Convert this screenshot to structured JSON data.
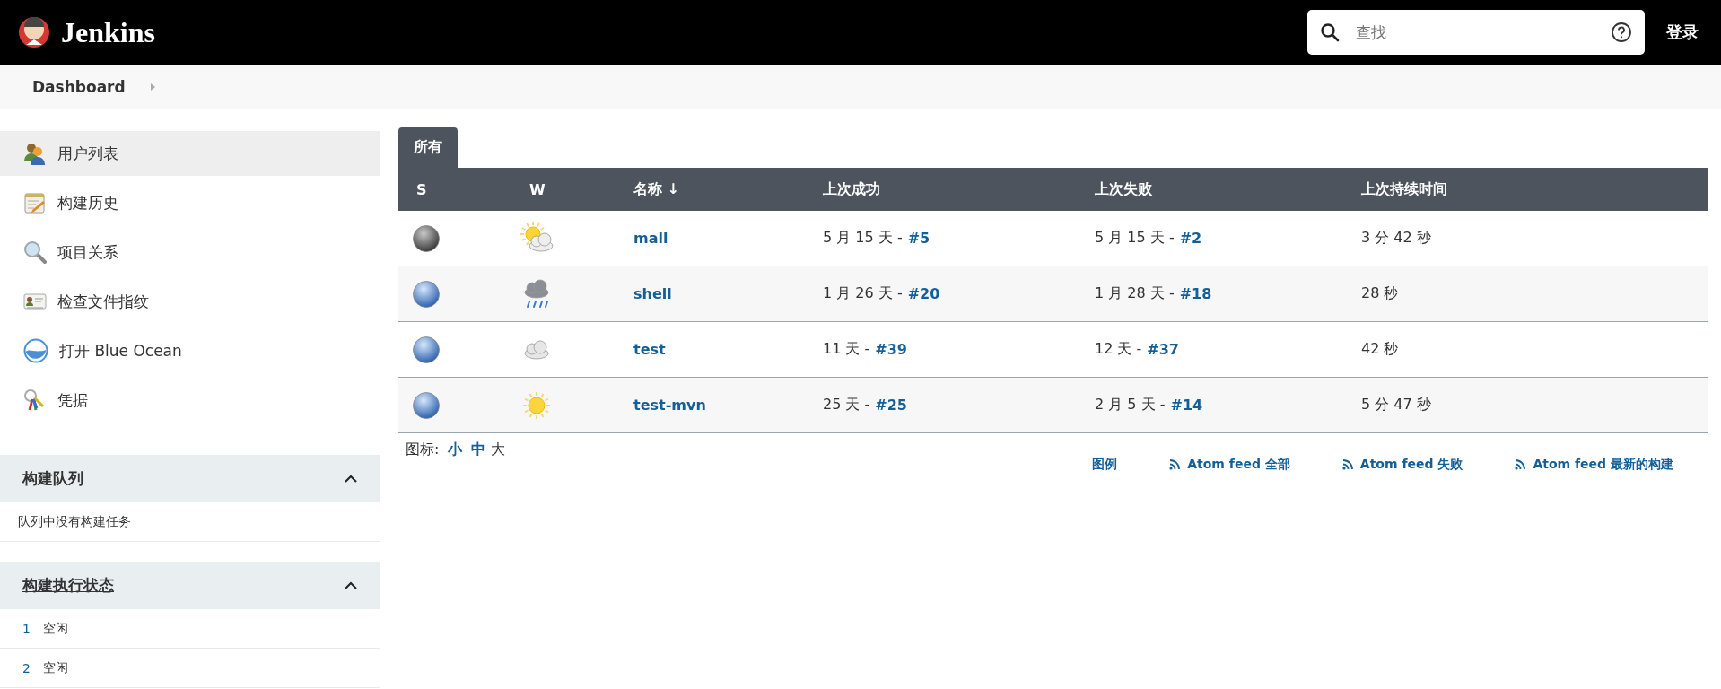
{
  "header": {
    "logo": "Jenkins",
    "search": {
      "placeholder": "查找"
    },
    "login": "登录"
  },
  "breadcrumb": [
    "Dashboard"
  ],
  "sidebar": {
    "items": [
      {
        "label": "用户列表",
        "selected": true
      },
      {
        "label": "构建历史",
        "selected": false
      },
      {
        "label": "项目关系",
        "selected": false
      },
      {
        "label": "检查文件指纹",
        "selected": false
      },
      {
        "label": "打开 Blue Ocean",
        "selected": false
      },
      {
        "label": "凭据",
        "selected": false
      }
    ]
  },
  "queue": {
    "title": "构建队列",
    "expanded": true,
    "message": "队列中没有构建任务"
  },
  "executors": {
    "title": "构建执行状态",
    "expanded": true,
    "rows": [
      {
        "number": "1",
        "status": "空闲"
      },
      {
        "number": "2",
        "status": "空闲"
      }
    ]
  },
  "tabs": [
    {
      "label": "所有",
      "selected": true
    }
  ],
  "table": {
    "columns": [
      "S",
      "W",
      "名称 ↓",
      "上次成功",
      "上次失败",
      "上次持续时间"
    ],
    "rows": [
      {
        "status_icon": {
          "kind": "grey"
        },
        "weather_icon": {
          "kind": "sun-cloud"
        },
        "name": "mall",
        "last_success": {
          "ago": "5 月 15 天 -",
          "build": "#5"
        },
        "last_failure": {
          "ago": "5 月 15 天 -",
          "build": "#2"
        },
        "duration": "3 分 42 秒"
      },
      {
        "status_icon": {
          "kind": "blue"
        },
        "weather_icon": {
          "kind": "storm"
        },
        "name": "shell",
        "last_success": {
          "ago": "1 月 26 天 -",
          "build": "#20"
        },
        "last_failure": {
          "ago": "1 月 28 天 -",
          "build": "#18"
        },
        "duration": "28 秒"
      },
      {
        "status_icon": {
          "kind": "blue"
        },
        "weather_icon": {
          "kind": "cloud"
        },
        "name": "test",
        "last_success": {
          "ago": "11 天 -",
          "build": "#39"
        },
        "last_failure": {
          "ago": "12 天 -",
          "build": "#37"
        },
        "duration": "42 秒"
      },
      {
        "status_icon": {
          "kind": "blue"
        },
        "weather_icon": {
          "kind": "sun"
        },
        "name": "test-mvn",
        "last_success": {
          "ago": "25 天 -",
          "build": "#25"
        },
        "last_failure": {
          "ago": "2 月 5 天 -",
          "build": "#14"
        },
        "duration": "5 分 47 秒"
      }
    ]
  },
  "icon_size": {
    "label": "图标:",
    "sizes": [
      {
        "label": "小",
        "selected": false
      },
      {
        "label": "中",
        "selected": false
      },
      {
        "label": "大",
        "selected": true
      }
    ]
  },
  "feeds": [
    {
      "kind": "legend",
      "label": "图例"
    },
    {
      "kind": "atom",
      "label": "Atom feed 全部"
    },
    {
      "kind": "atom",
      "label": "Atom feed 失败"
    },
    {
      "kind": "atom",
      "label": "Atom feed 最新的构建"
    }
  ]
}
